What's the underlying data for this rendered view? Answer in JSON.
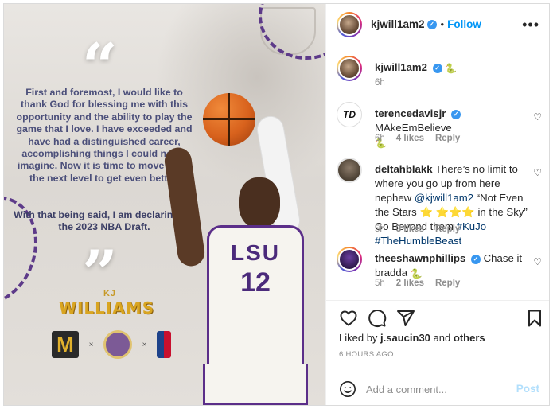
{
  "post": {
    "statement": "First and foremost, I would like to thank God for blessing me with this opportunity and the ability to play the game that I love. I have exceeded and have had a distinguished career, accomplishing things I could never imagine. Now it is time to move on to the next level to get even better.",
    "statement2": "With that being said, I am declaring for the 2023 NBA Draft.",
    "sig_kj": "KJ",
    "sig_name": "WILLIAMS",
    "logo_m": "M",
    "logo_x1": "×",
    "logo_x2": "×",
    "jersey_text": "LSU",
    "jersey_number": "12"
  },
  "header": {
    "username": "kjwill1am2",
    "dot": "•",
    "follow_label": "Follow",
    "more_label": "•••"
  },
  "comments": [
    {
      "username": "kjwill1am2",
      "emoji": "🐍",
      "time": "6h"
    },
    {
      "username": "terencedavisjr",
      "text": "MAkeEmBelieve",
      "emoji": "🐍",
      "time": "6h",
      "likes": "4 likes",
      "reply": "Reply",
      "avatar_text": "TD"
    },
    {
      "username": "deltahblakk",
      "text_a": "There’s no limit to where you go up from here nephew",
      "mention": "@kjwill1am2",
      "text_b": "“Not Even the Stars",
      "stars_a": "⭐",
      "stars_b": "⭐⭐⭐",
      "text_c": "in the Sky” Go Beyond them",
      "hashtag1": "#KuJo",
      "hashtag2": "#TheHumbleBeast",
      "time": "5h",
      "likes": "3 likes",
      "reply": "Reply"
    },
    {
      "username": "theeshawnphillips",
      "text": "Chase it bradda",
      "emoji": "🐍",
      "time": "5h",
      "likes": "2 likes",
      "reply": "Reply"
    }
  ],
  "liked_by": {
    "prefix": "Liked by",
    "user": "j.saucin30",
    "and": "and",
    "others": "others"
  },
  "timestamp": "6 HOURS AGO",
  "composer": {
    "placeholder": "Add a comment...",
    "post_label": "Post"
  },
  "colors": {
    "accent": "#0095f6",
    "verified": "#3897f0",
    "lsu_purple": "#5b2e89",
    "gold": "#d9a521"
  },
  "icons": [
    "heart-icon",
    "comment-icon",
    "share-icon",
    "bookmark-icon",
    "emoji-icon",
    "more-icon",
    "verified-icon"
  ]
}
